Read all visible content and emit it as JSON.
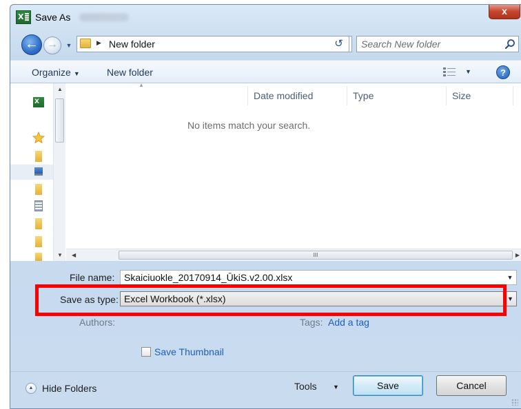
{
  "window": {
    "title": "Save As",
    "close_symbol": "x"
  },
  "nav": {
    "back_symbol": "←",
    "forward_symbol": "→",
    "address_path": "New folder",
    "search_placeholder": "Search New folder",
    "refresh_symbol": "↺"
  },
  "toolbar": {
    "organize_label": "Organize",
    "new_folder_label": "New folder",
    "help_symbol": "?"
  },
  "columns": {
    "date_modified": "Date modified",
    "type": "Type",
    "size": "Size"
  },
  "file_list": {
    "empty_message": "No items match your search.",
    "scroll_mark": "III"
  },
  "form": {
    "file_name_label": "File name:",
    "file_name_value": "Skaiciuokle_20170914_ŪkiS.v2.00.xlsx",
    "save_type_label": "Save as type:",
    "save_type_value": "Excel Workbook (*.xlsx)",
    "authors_label": "Authors:",
    "tags_label": "Tags:",
    "tags_link": "Add a tag",
    "save_thumbnail_label": "Save Thumbnail"
  },
  "footer": {
    "hide_folders_label": "Hide Folders",
    "tools_label": "Tools",
    "save_label": "Save",
    "cancel_label": "Cancel"
  },
  "colors": {
    "highlight": "#ff0000",
    "link": "#1f5fb9",
    "toolbar_text": "#1e395b"
  }
}
